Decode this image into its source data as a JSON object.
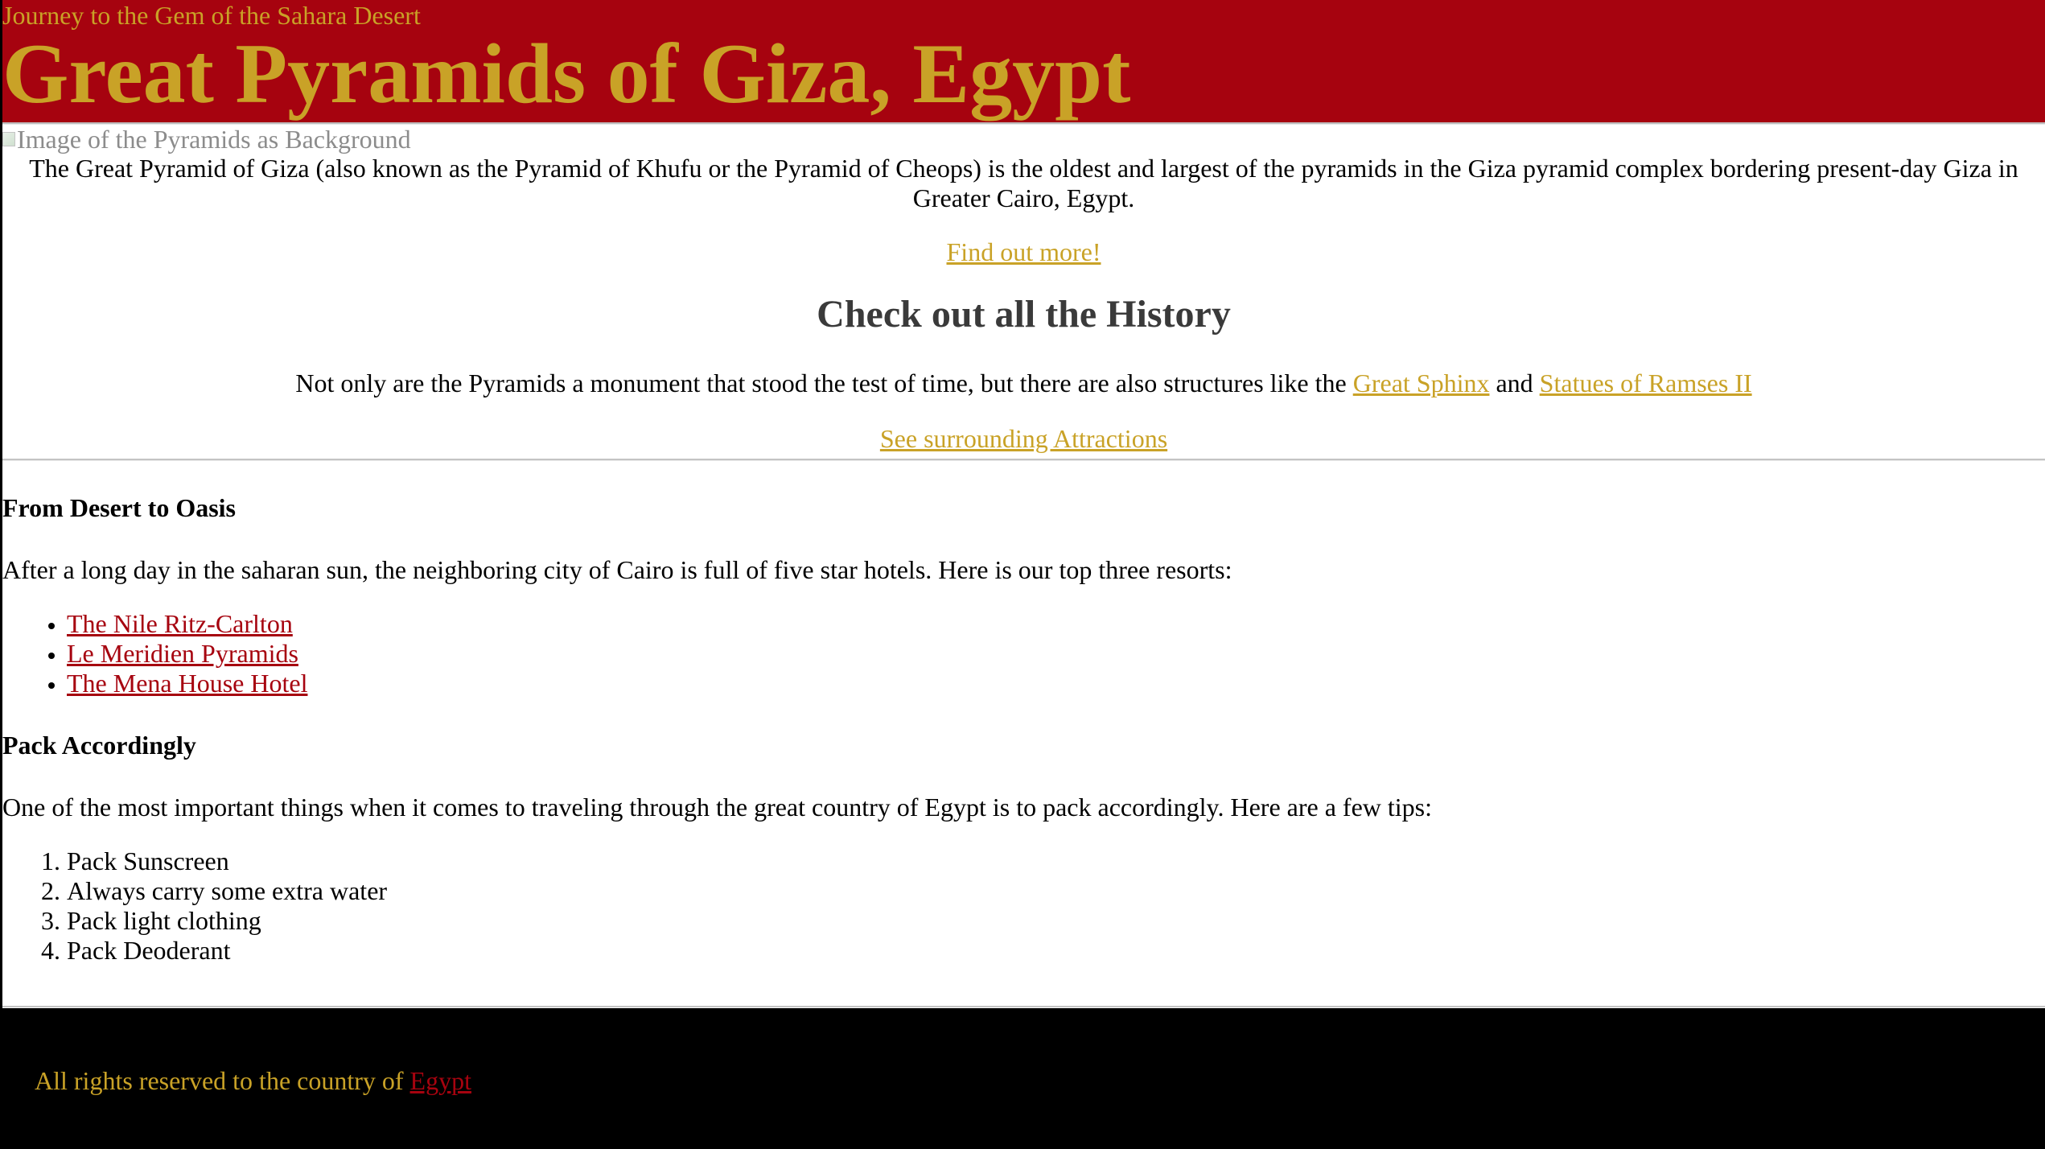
{
  "header": {
    "tagline": "Journey to the Gem of the Sahara Desert",
    "title": "Great Pyramids of Giza, Egypt",
    "background_color": "#a6030f",
    "title_color": "#c9a227"
  },
  "hero": {
    "image_alt": "Image of the Pyramids as Background",
    "intro": "The Great Pyramid of Giza (also known as the Pyramid of Khufu or the Pyramid of Cheops) is the oldest and largest of the pyramids in the Giza pyramid complex bordering present-day Giza in Greater Cairo, Egypt.",
    "find_more_link": "Find out more!"
  },
  "history": {
    "heading": "Check out all the History",
    "text_before": "Not only are the Pyramids a monument that stood the test of time, but there are also structures like the ",
    "link_sphinx": "Great Sphinx",
    "text_and": " and ",
    "link_ramses": "Statues of Ramses II",
    "attractions_link": "See surrounding Attractions"
  },
  "oasis": {
    "heading": "From Desert to Oasis",
    "text": "After a long day in the saharan sun, the neighboring city of Cairo is full of five star hotels. Here is our top three resorts:",
    "hotels": [
      "The Nile Ritz-Carlton",
      "Le Meridien Pyramids",
      "The Mena House Hotel"
    ]
  },
  "packing": {
    "heading": "Pack Accordingly",
    "text": "One of the most important things when it comes to traveling through the great country of Egypt is to pack accordingly. Here are a few tips:",
    "tips": [
      "Pack Sunscreen",
      "Always carry some extra water",
      "Pack light clothing",
      "Pack Deoderant"
    ]
  },
  "footer": {
    "text": "All rights reserved to the country of ",
    "link": "Egypt",
    "background_color": "#000000"
  },
  "icons": {
    "broken_image": "broken-image-icon"
  }
}
